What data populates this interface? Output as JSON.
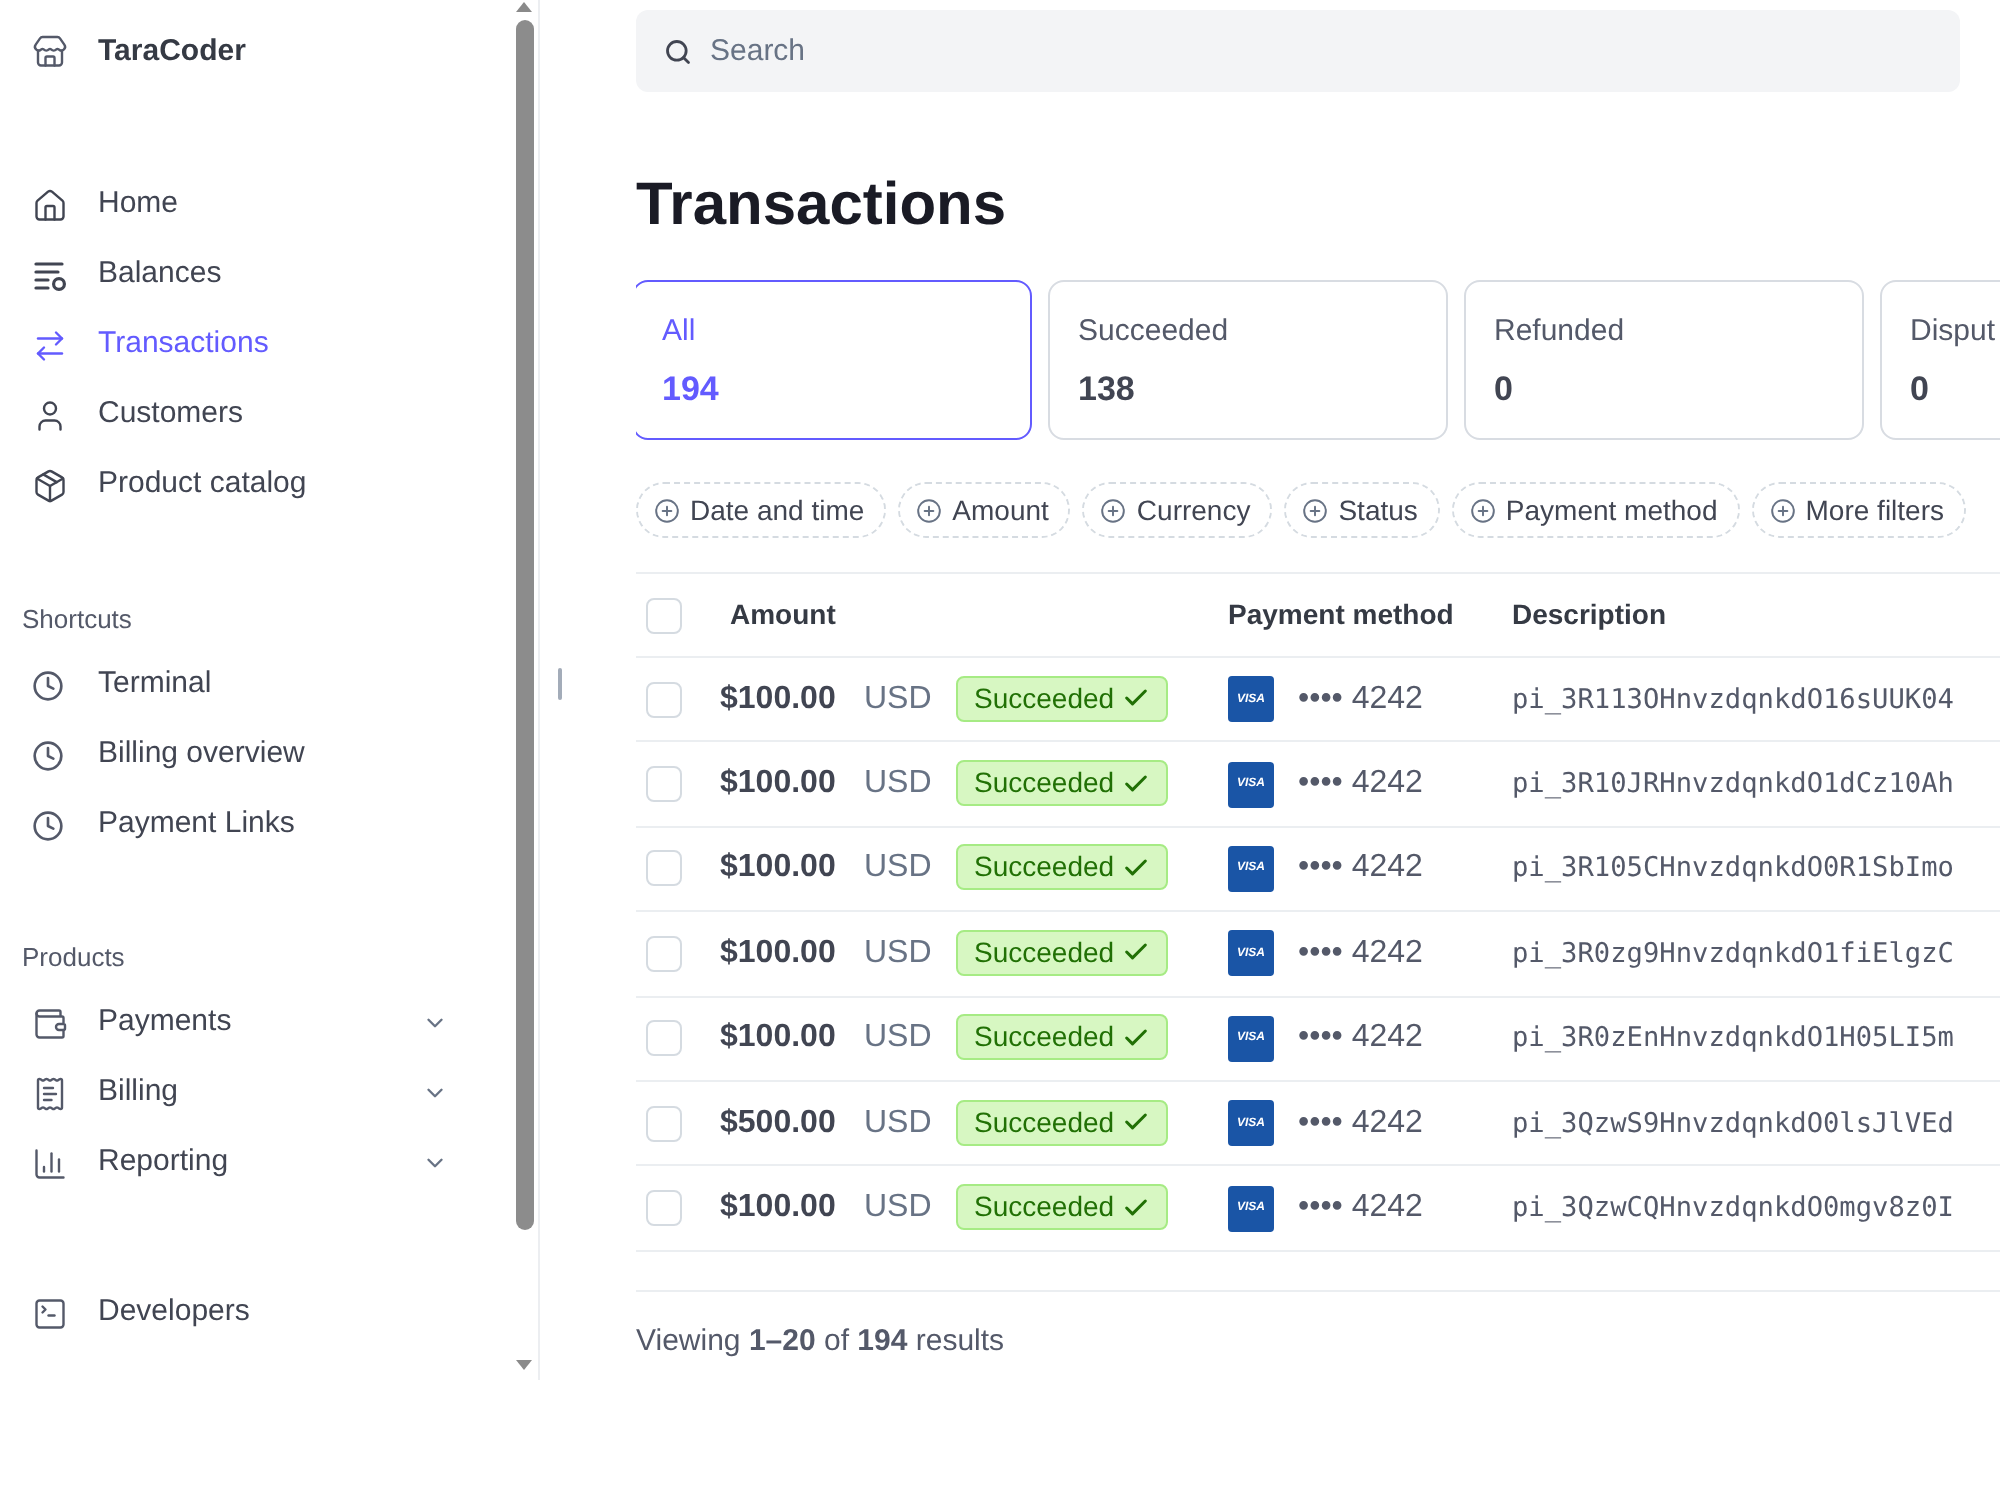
{
  "sidebar": {
    "account": "TaraCoder",
    "nav": [
      {
        "label": "Home",
        "selected": false
      },
      {
        "label": "Balances",
        "selected": false
      },
      {
        "label": "Transactions",
        "selected": true
      },
      {
        "label": "Customers",
        "selected": false
      },
      {
        "label": "Product catalog",
        "selected": false
      }
    ],
    "shortcuts": {
      "heading": "Shortcuts",
      "items": [
        {
          "label": "Terminal"
        },
        {
          "label": "Billing overview"
        },
        {
          "label": "Payment Links"
        }
      ]
    },
    "products": {
      "heading": "Products",
      "items": [
        {
          "label": "Payments",
          "expanded": false
        },
        {
          "label": "Billing",
          "expanded": false
        },
        {
          "label": "Reporting",
          "expanded": false
        }
      ]
    },
    "developers": {
      "label": "Developers"
    }
  },
  "search": {
    "placeholder": "Search"
  },
  "title": "Transactions",
  "status_tabs": [
    {
      "label": "All",
      "count": "194",
      "selected": true
    },
    {
      "label": "Succeeded",
      "count": "138",
      "selected": false
    },
    {
      "label": "Refunded",
      "count": "0",
      "selected": false
    },
    {
      "label": "Disput",
      "count": "0",
      "selected": false
    }
  ],
  "filters": [
    "Date and time",
    "Amount",
    "Currency",
    "Status",
    "Payment method",
    "More filters"
  ],
  "table": {
    "columns": [
      "Amount",
      "Payment method",
      "Description"
    ],
    "header_checked": false,
    "rows": [
      {
        "checked": false,
        "amount": "$100.00",
        "currency": "USD",
        "status": "Succeeded",
        "kind": "succeeded",
        "brand": "VISA",
        "card": "•••• 4242",
        "description": "pi_3R113OHnvzdqnkdO16sUUK04"
      },
      {
        "checked": false,
        "amount": "$100.00",
        "currency": "USD",
        "status": "Succeeded",
        "kind": "succeeded",
        "brand": "VISA",
        "card": "•••• 4242",
        "description": "pi_3R10JRHnvzdqnkdO1dCz10Ah"
      },
      {
        "checked": false,
        "amount": "$100.00",
        "currency": "USD",
        "status": "Succeeded",
        "kind": "succeeded",
        "brand": "VISA",
        "card": "•••• 4242",
        "description": "pi_3R105CHnvzdqnkdO0R1SbImo"
      },
      {
        "checked": false,
        "amount": "$100.00",
        "currency": "USD",
        "status": "Succeeded",
        "kind": "succeeded",
        "brand": "VISA",
        "card": "•••• 4242",
        "description": "pi_3R0zg9HnvzdqnkdO1fiElgzC"
      },
      {
        "checked": false,
        "amount": "$100.00",
        "currency": "USD",
        "status": "Succeeded",
        "kind": "succeeded",
        "brand": "VISA",
        "card": "•••• 4242",
        "description": "pi_3R0zEnHnvzdqnkdO1H05LI5m"
      },
      {
        "checked": false,
        "amount": "$500.00",
        "currency": "USD",
        "status": "Succeeded",
        "kind": "succeeded",
        "brand": "VISA",
        "card": "•••• 4242",
        "description": "pi_3QzwS9HnvzdqnkdO0lsJlVEd"
      },
      {
        "checked": false,
        "amount": "$100.00",
        "currency": "USD",
        "status": "Succeeded",
        "kind": "succeeded",
        "brand": "VISA",
        "card": "•••• 4242",
        "description": "pi_3QzwCQHnvzdqnkdO0mgv8z0I"
      }
    ]
  },
  "footer": "Viewing **1–20** of **194** results"
}
